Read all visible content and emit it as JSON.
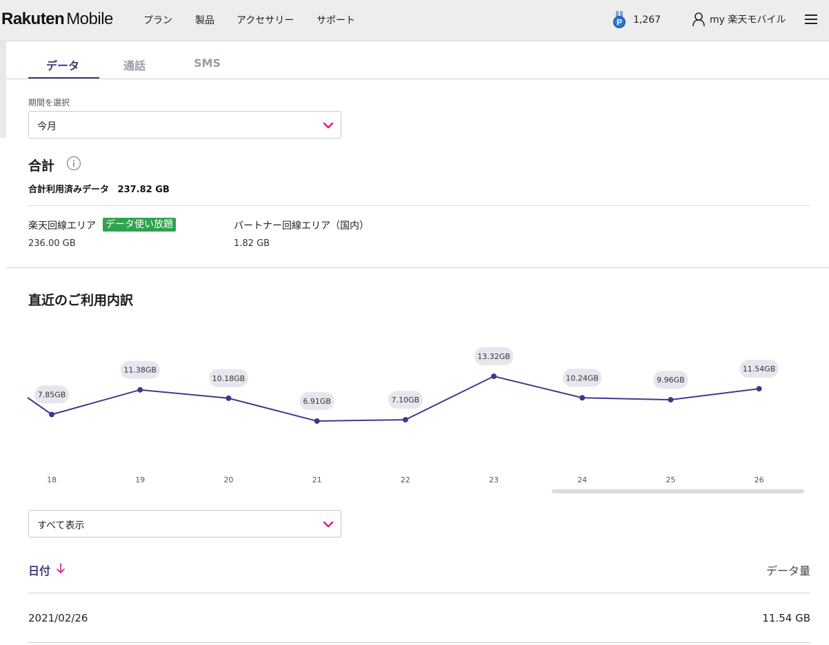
{
  "header": {
    "logo_bold": "Rakuten",
    "logo_light": "Mobile",
    "nav": [
      "プラン",
      "製品",
      "アクセサリー",
      "サポート"
    ],
    "points_icon": "rakuten-points-medal-icon",
    "points": "1,267",
    "account_icon": "user-icon",
    "account_label": "my 楽天モバイル",
    "menu_icon": "hamburger-menu-icon"
  },
  "tabs": [
    {
      "label": "データ",
      "active": true
    },
    {
      "label": "通話",
      "active": false
    },
    {
      "label": "SMS",
      "active": false
    }
  ],
  "period": {
    "label": "期間を選択",
    "value": "今月"
  },
  "total": {
    "heading": "合計",
    "summary_label": "合計利用済みデータ",
    "summary_value": "237.82 GB",
    "rakuten_area_label": "楽天回線エリア",
    "rakuten_area_badge": "データ使い放題",
    "rakuten_area_value": "236.00 GB",
    "partner_area_label": "パートナー回線エリア（国内）",
    "partner_area_value": "1.82 GB"
  },
  "recent": {
    "heading": "直近のご利用内訳"
  },
  "chart_data": {
    "type": "line",
    "categories": [
      "18",
      "19",
      "20",
      "21",
      "22",
      "23",
      "24",
      "25",
      "26"
    ],
    "values": [
      7.85,
      11.38,
      10.18,
      6.91,
      7.1,
      13.32,
      10.24,
      9.96,
      11.54
    ],
    "labels": [
      "7.85GB",
      "11.38GB",
      "10.18GB",
      "6.91GB",
      "7.10GB",
      "13.32GB",
      "10.24GB",
      "9.96GB",
      "11.54GB"
    ],
    "unit": "GB",
    "grid": false,
    "line_color": "#3b3a8c"
  },
  "filter": {
    "value": "すべて表示"
  },
  "table": {
    "col_date": "日付",
    "col_amount": "データ量",
    "rows": [
      {
        "date": "2021/02/26",
        "amount": "11.54 GB"
      }
    ]
  },
  "colors": {
    "accent": "#3b3775",
    "chevron": "#e0167f",
    "badge": "#2fa24f"
  }
}
